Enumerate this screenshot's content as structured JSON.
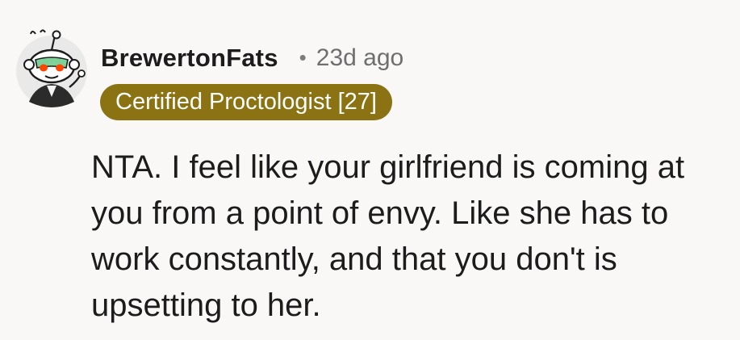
{
  "comment": {
    "author": "BrewertonFats",
    "separator": "•",
    "age": "23d ago",
    "flair": "Certified Proctologist [27]",
    "body": "NTA. I feel like your girlfriend is coming at you from a point of envy. Like she has to work constantly, and that you don't is upsetting to her.",
    "avatar_icon": "snoo-avatar-icon"
  },
  "colors": {
    "background": "#f9f8f7",
    "flair_background": "#8b7313",
    "flair_text": "#ffffff",
    "author_text": "#1c1c1c",
    "meta_text": "#6f6f6f",
    "body_text": "#1c1c1c"
  }
}
